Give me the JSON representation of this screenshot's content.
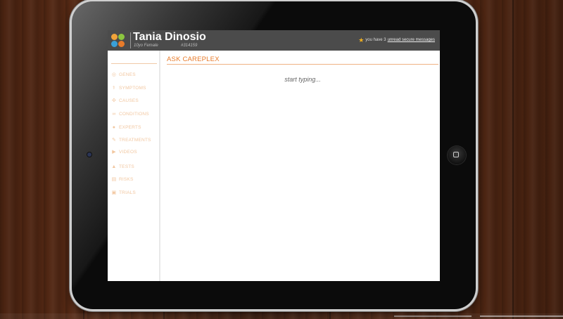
{
  "patient": {
    "name": "Tania Dinosio",
    "demographics": "10yo Female",
    "id": "#314159"
  },
  "notifications": {
    "prefix": "you have 3",
    "link": "unread secure messages"
  },
  "sidebar": {
    "items": [
      {
        "label": "GENES",
        "icon": "gene-icon"
      },
      {
        "label": "SYMPTOMS",
        "icon": "symptoms-icon"
      },
      {
        "label": "CAUSES",
        "icon": "causes-icon"
      },
      {
        "label": "CONDITIONS",
        "icon": "conditions-icon"
      },
      {
        "label": "EXPERTS",
        "icon": "experts-icon"
      },
      {
        "label": "TREATMENTS",
        "icon": "treatments-icon"
      },
      {
        "label": "VIDEOS",
        "icon": "video-icon"
      },
      {
        "label": "TESTS",
        "icon": "tests-icon"
      },
      {
        "label": "RISKS",
        "icon": "risks-icon"
      },
      {
        "label": "TRIALS",
        "icon": "trials-icon"
      }
    ]
  },
  "main": {
    "title": "ASK CAREPLEX",
    "search_placeholder": "start typing..."
  },
  "colors": {
    "accent": "#e87b2a",
    "nav_text": "#f2c7a0",
    "header_bg": "#4b4b4b",
    "logo_dots": [
      "#f0a33a",
      "#8cc63f",
      "#3aa0d8",
      "#e87b2a"
    ]
  }
}
